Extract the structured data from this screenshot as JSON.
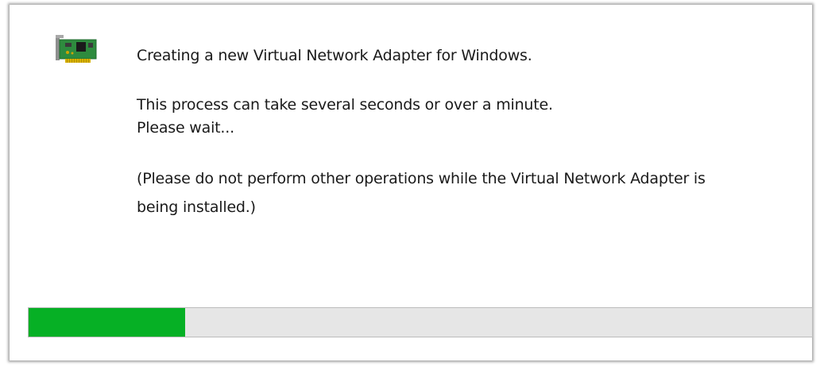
{
  "message": {
    "title": "Creating a new Virtual Network Adapter for Windows.",
    "line2": "This process can take several seconds or over a minute.",
    "line3": "Please wait...",
    "line4": "(Please do not perform other operations while the Virtual Network Adapter is",
    "line5": "being installed.)"
  },
  "icon": {
    "name": "network-adapter-card-icon"
  },
  "progress": {
    "value": 0.2,
    "color": "#06b025",
    "track_color": "#e6e6e6"
  }
}
